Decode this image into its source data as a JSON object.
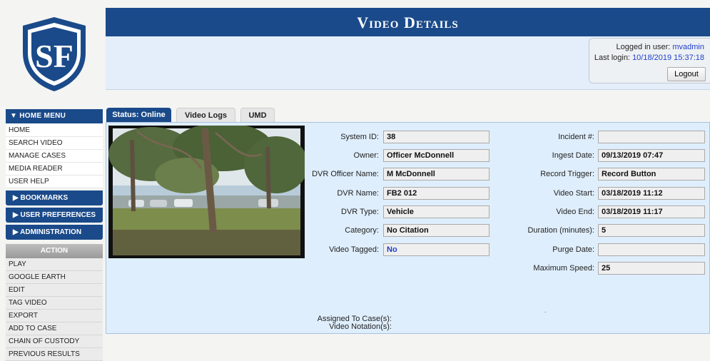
{
  "header": {
    "title": "Video Details"
  },
  "login": {
    "user_label": "Logged in user:",
    "user": "mvadmin",
    "last_login_label": "Last login:",
    "last_login": "10/18/2019 15:37:18",
    "logout_label": "Logout"
  },
  "sidebar": {
    "home_menu": "Home Menu",
    "home_items": [
      "Home",
      "Search Video",
      "Manage Cases",
      "Media Reader",
      "User Help"
    ],
    "bookmarks": "Bookmarks",
    "user_preferences": "User Preferences",
    "administration": "Administration",
    "action_head": "Action",
    "action_items": [
      "Play",
      "Google Earth",
      "Edit",
      "Tag Video",
      "Export",
      "Add To Case",
      "Chain of Custody",
      "Previous Results"
    ]
  },
  "tabs": [
    "Status: Online",
    "Video Logs",
    "UMD"
  ],
  "video": {
    "left_fields": [
      {
        "label": "System ID:",
        "value": "38"
      },
      {
        "label": "Owner:",
        "value": "Officer McDonnell"
      },
      {
        "label": "DVR Officer Name:",
        "value": "M McDonnell"
      },
      {
        "label": "DVR Name:",
        "value": "FB2 012"
      },
      {
        "label": "DVR Type:",
        "value": "Vehicle"
      },
      {
        "label": "Category:",
        "value": "No Citation"
      },
      {
        "label": "Video Tagged:",
        "value": "No"
      }
    ],
    "right_fields": [
      {
        "label": "Incident #:",
        "value": ""
      },
      {
        "label": "Ingest Date:",
        "value": "09/13/2019 07:47"
      },
      {
        "label": "Record Trigger:",
        "value": "Record Button"
      },
      {
        "label": "Video Start:",
        "value": "03/18/2019 11:12"
      },
      {
        "label": "Video End:",
        "value": "03/18/2019 11:17"
      },
      {
        "label": "Duration (minutes):",
        "value": "5"
      },
      {
        "label": "Purge Date:",
        "value": ""
      },
      {
        "label": "Maximum Speed:",
        "value": "25"
      }
    ],
    "assigned_label": "Assigned To Case(s):",
    "notation_label": "Video Notation(s):"
  },
  "colors": {
    "nav_blue": "#1a4a8a",
    "panel_blue": "#dfeefc",
    "link_blue": "#1f3fc8"
  },
  "icons": {
    "logo": "sf-shield-logo"
  }
}
